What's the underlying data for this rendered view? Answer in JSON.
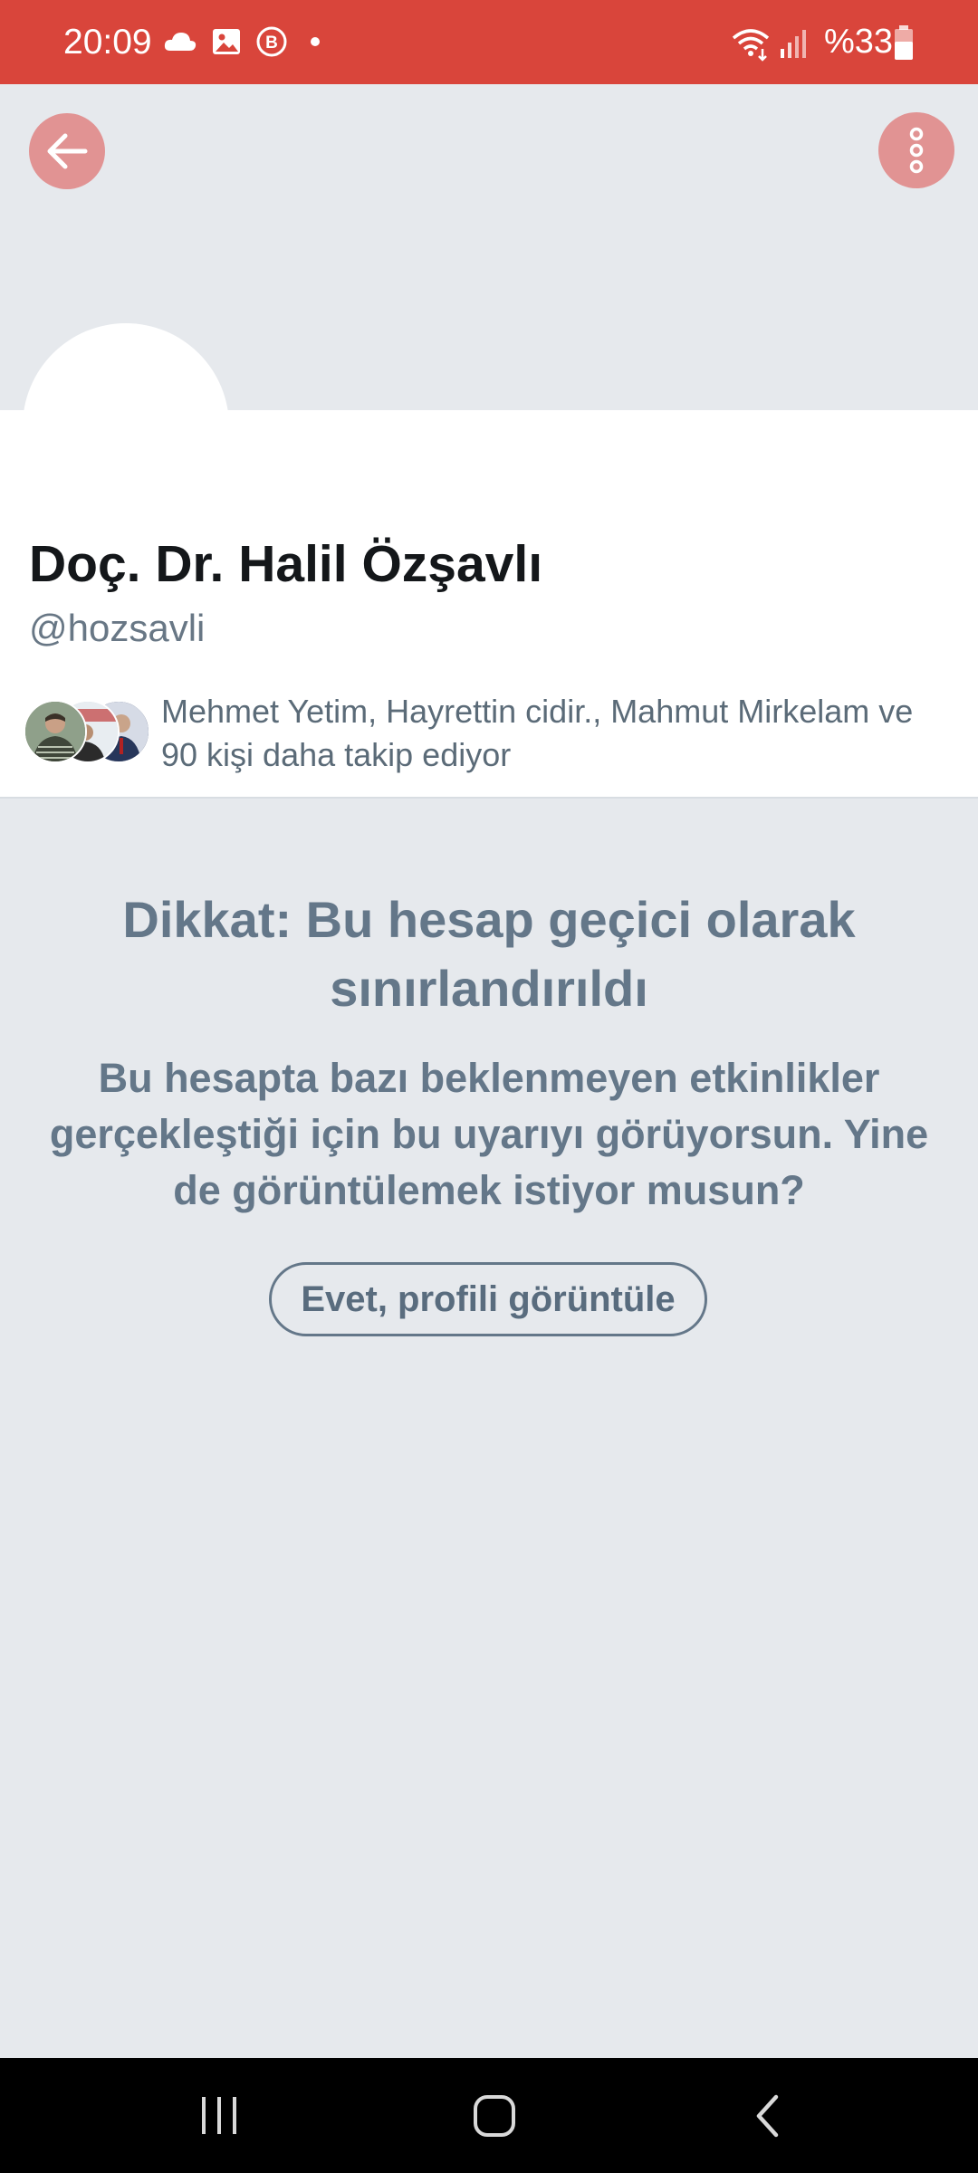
{
  "status_bar": {
    "time": "20:09",
    "battery": "%33",
    "icons": [
      "cloud-icon",
      "gallery-icon",
      "b-notification-icon",
      "dot-icon",
      "wifi-icon",
      "signal-icon",
      "battery-icon"
    ],
    "background_color": "#d9453b"
  },
  "header": {
    "back_icon": "arrow-left-icon",
    "more_icon": "more-vertical-icon",
    "button_color": "#e19393"
  },
  "profile": {
    "display_name": "Doç. Dr. Halil Özşavlı",
    "handle": "@hozsavli",
    "followed_by": "Mehmet Yetim, Hayrettin cidir., Mahmut Mirkelam ve 90 kişi daha takip ediyor"
  },
  "warning": {
    "title": "Dikkat: Bu hesap geçici olarak sınırlandırıldı",
    "body": "Bu hesapta bazı beklenmeyen etkinlikler gerçekleştiği için bu uyarıyı görüyorsun. Yine de görüntülemek istiyor musun?",
    "button_label": "Evet, profili görüntüle",
    "text_color": "#647789"
  },
  "nav_bar": {
    "icons": [
      "recents-icon",
      "home-icon",
      "back-icon"
    ]
  }
}
